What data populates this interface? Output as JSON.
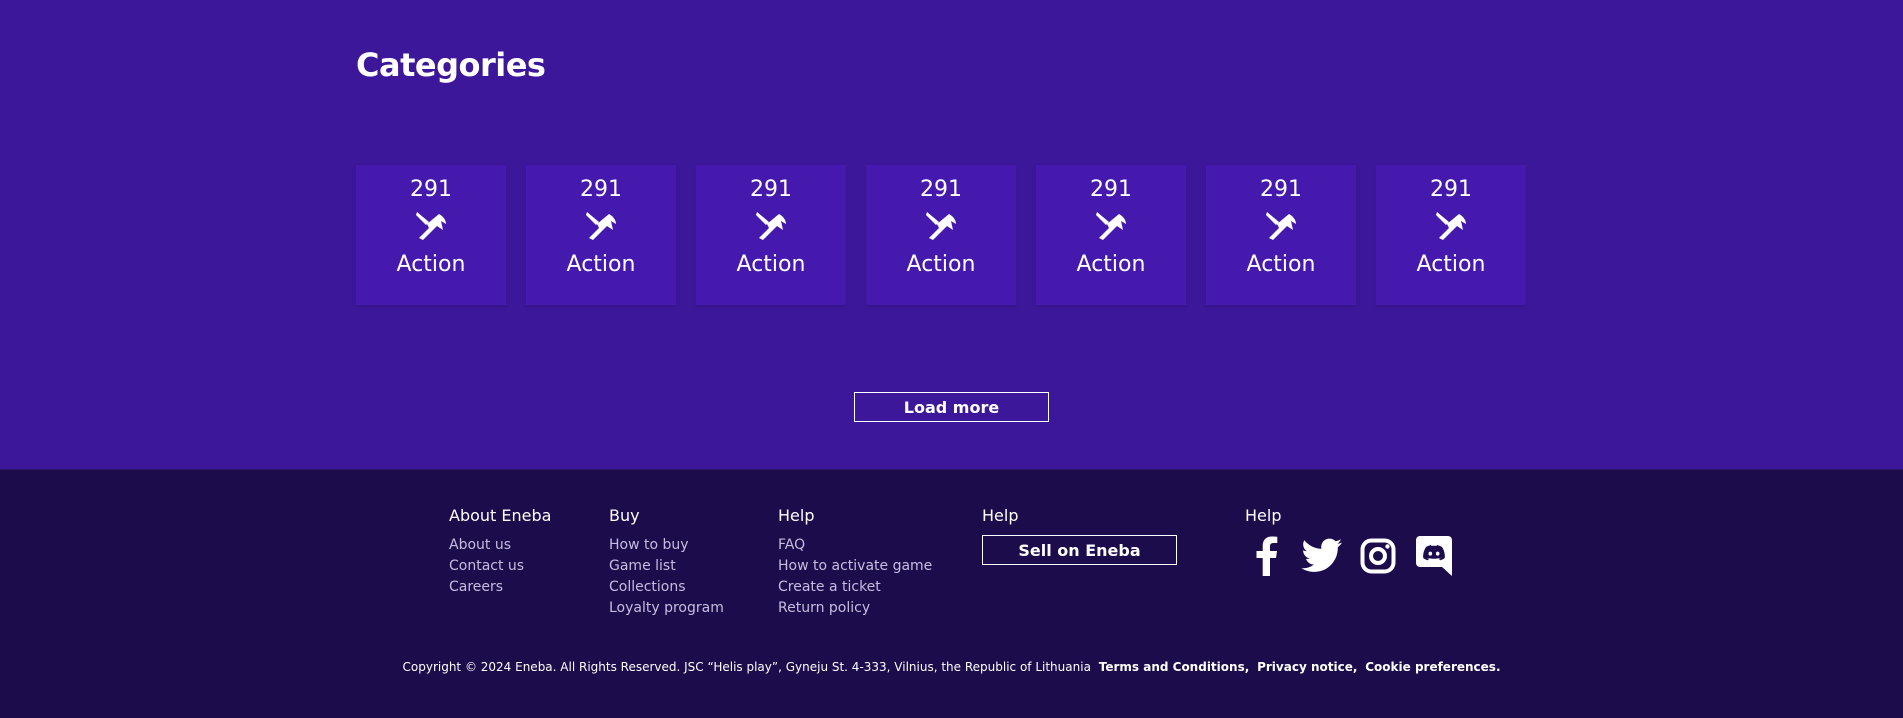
{
  "categories": {
    "title": "Categories",
    "items": [
      {
        "count": "291",
        "label": "Action",
        "icon": "pickaxe-icon"
      },
      {
        "count": "291",
        "label": "Action",
        "icon": "pickaxe-icon"
      },
      {
        "count": "291",
        "label": "Action",
        "icon": "pickaxe-icon"
      },
      {
        "count": "291",
        "label": "Action",
        "icon": "pickaxe-icon"
      },
      {
        "count": "291",
        "label": "Action",
        "icon": "pickaxe-icon"
      },
      {
        "count": "291",
        "label": "Action",
        "icon": "pickaxe-icon"
      },
      {
        "count": "291",
        "label": "Action",
        "icon": "pickaxe-icon"
      }
    ],
    "load_more_label": "Load more"
  },
  "footer": {
    "about": {
      "heading": "About Eneba",
      "links": [
        "About us",
        "Contact us",
        "Careers"
      ]
    },
    "buy": {
      "heading": "Buy",
      "links": [
        "How to buy",
        "Game list",
        "Collections",
        "Loyalty program"
      ]
    },
    "help": {
      "heading": "Help",
      "links": [
        "FAQ",
        "How to activate game",
        "Create a ticket",
        "Return policy"
      ]
    },
    "sell": {
      "heading": "Help",
      "button_label": "Sell on Eneba"
    },
    "social": {
      "heading": "Help",
      "icons": [
        "facebook-icon",
        "twitter-icon",
        "instagram-icon",
        "discord-icon"
      ]
    },
    "copyright": "Copyright © 2024 Eneba. All Rights Reserved. JSC “Helis play”, Gyneju St. 4-333, Vilnius, the Republic of Lithuania",
    "legal_links": [
      "Terms and Conditions,",
      "Privacy notice,",
      "Cookie preferences."
    ]
  },
  "colors": {
    "main_bg": "#3d179a",
    "card_bg": "#4519ad",
    "footer_bg": "#1c0c4b",
    "footer_link": "#c4bde0"
  }
}
